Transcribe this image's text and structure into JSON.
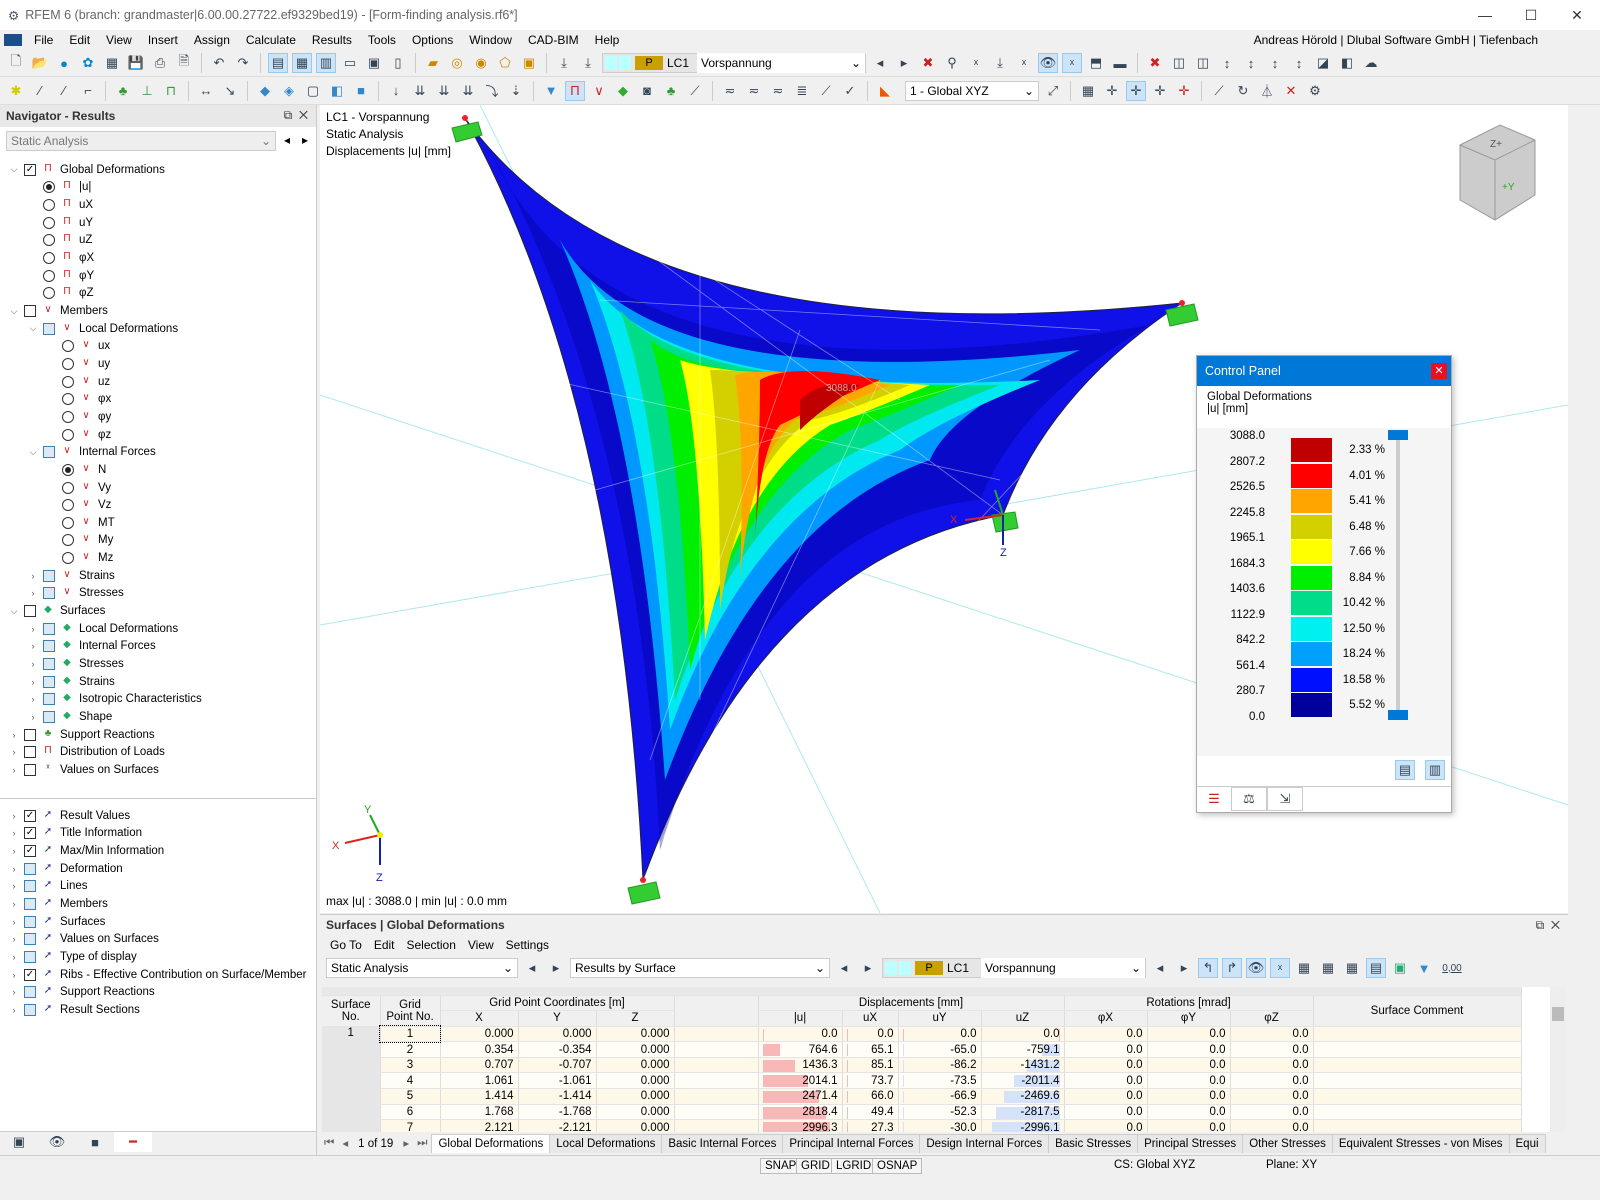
{
  "window": {
    "title": "RFEM 6 (branch: grandmaster|6.00.00.27722.ef9329bed19) - [Form-finding analysis.rf6*]"
  },
  "menu": [
    "File",
    "Edit",
    "View",
    "Insert",
    "Assign",
    "Calculate",
    "Results",
    "Tools",
    "Options",
    "Window",
    "CAD-BIM",
    "Help"
  ],
  "user": "Andreas Hörold | Dlubal Software GmbH | Tiefenbach",
  "toolbar": {
    "load_type": "P",
    "load_case": "LC1",
    "load_case_name": "Vorspannung",
    "coord_system": "1 - Global XYZ"
  },
  "navigator": {
    "title": "Navigator - Results",
    "analysis": "Static Analysis",
    "items": [
      {
        "l": 0,
        "t": "cb",
        "c": true,
        "e": "v",
        "i": "def",
        "label": "Global Deformations"
      },
      {
        "l": 1,
        "t": "rb",
        "c": true,
        "i": "def",
        "label": "|u|"
      },
      {
        "l": 1,
        "t": "rb",
        "i": "def",
        "label": "uX"
      },
      {
        "l": 1,
        "t": "rb",
        "i": "def",
        "label": "uY"
      },
      {
        "l": 1,
        "t": "rb",
        "i": "def",
        "label": "uZ"
      },
      {
        "l": 1,
        "t": "rb",
        "i": "def",
        "label": "φX"
      },
      {
        "l": 1,
        "t": "rb",
        "i": "def",
        "label": "φY"
      },
      {
        "l": 1,
        "t": "rb",
        "i": "def",
        "label": "φZ"
      },
      {
        "l": 0,
        "t": "cb",
        "e": "v",
        "i": "mem",
        "label": "Members"
      },
      {
        "l": 1,
        "t": "cbb",
        "e": "v",
        "i": "mem",
        "label": "Local Deformations"
      },
      {
        "l": 2,
        "t": "rb",
        "i": "mem",
        "label": "ux"
      },
      {
        "l": 2,
        "t": "rb",
        "i": "mem",
        "label": "uy"
      },
      {
        "l": 2,
        "t": "rb",
        "i": "mem",
        "label": "uz"
      },
      {
        "l": 2,
        "t": "rb",
        "i": "mem",
        "label": "φx"
      },
      {
        "l": 2,
        "t": "rb",
        "i": "mem",
        "label": "φy"
      },
      {
        "l": 2,
        "t": "rb",
        "i": "mem",
        "label": "φz"
      },
      {
        "l": 1,
        "t": "cbb",
        "e": "v",
        "i": "mem",
        "label": "Internal Forces"
      },
      {
        "l": 2,
        "t": "rb",
        "c": true,
        "i": "mem",
        "label": "N"
      },
      {
        "l": 2,
        "t": "rb",
        "i": "mem",
        "label": "Vy"
      },
      {
        "l": 2,
        "t": "rb",
        "i": "mem",
        "label": "Vz"
      },
      {
        "l": 2,
        "t": "rb",
        "i": "mem",
        "label": "MT"
      },
      {
        "l": 2,
        "t": "rb",
        "i": "mem",
        "label": "My"
      },
      {
        "l": 2,
        "t": "rb",
        "i": "mem",
        "label": "Mz"
      },
      {
        "l": 1,
        "t": "cbb",
        "e": ">",
        "i": "mem",
        "label": "Strains"
      },
      {
        "l": 1,
        "t": "cbb",
        "e": ">",
        "i": "mem",
        "label": "Stresses"
      },
      {
        "l": 0,
        "t": "cb",
        "e": "v",
        "i": "srf",
        "label": "Surfaces"
      },
      {
        "l": 1,
        "t": "cbb",
        "e": ">",
        "i": "srf",
        "label": "Local Deformations"
      },
      {
        "l": 1,
        "t": "cbb",
        "e": ">",
        "i": "srf",
        "label": "Internal Forces"
      },
      {
        "l": 1,
        "t": "cbb",
        "e": ">",
        "i": "srf",
        "label": "Stresses"
      },
      {
        "l": 1,
        "t": "cbb",
        "e": ">",
        "i": "srf",
        "label": "Strains"
      },
      {
        "l": 1,
        "t": "cbb",
        "e": ">",
        "i": "srf",
        "label": "Isotropic Characteristics"
      },
      {
        "l": 1,
        "t": "cbb",
        "e": ">",
        "i": "srf",
        "label": "Shape"
      },
      {
        "l": 0,
        "t": "cb",
        "e": ">",
        "i": "sup",
        "label": "Support Reactions"
      },
      {
        "l": 0,
        "t": "cb",
        "e": ">",
        "i": "def",
        "label": "Distribution of Loads"
      },
      {
        "l": 0,
        "t": "cb",
        "e": ">",
        "i": "val",
        "label": "Values on Surfaces"
      }
    ],
    "display_items": [
      {
        "c": true,
        "label": "Result Values"
      },
      {
        "c": true,
        "label": "Title Information"
      },
      {
        "c": true,
        "label": "Max/Min Information"
      },
      {
        "label": "Deformation"
      },
      {
        "label": "Lines"
      },
      {
        "label": "Members"
      },
      {
        "label": "Surfaces"
      },
      {
        "label": "Values on Surfaces"
      },
      {
        "label": "Type of display"
      },
      {
        "c": true,
        "label": "Ribs - Effective Contribution on Surface/Member"
      },
      {
        "label": "Support Reactions"
      },
      {
        "label": "Result Sections"
      }
    ]
  },
  "viewport": {
    "line1": "LC1 - Vorspannung",
    "line2": "Static Analysis",
    "line3": "Displacements |u| [mm]",
    "maxmin": "max |u| : 3088.0 | min |u| : 0.0 mm",
    "max_label": "3088.0",
    "axes": {
      "x": "X",
      "y": "Y",
      "z": "Z"
    }
  },
  "control_panel": {
    "title": "Control Panel",
    "subtitle": "Global Deformations",
    "unit": "|u| [mm]",
    "values": [
      "3088.0",
      "2807.2",
      "2526.5",
      "2245.8",
      "1965.1",
      "1684.3",
      "1403.6",
      "1122.9",
      "842.2",
      "561.4",
      "280.7",
      "0.0"
    ],
    "colors": [
      "#c00000",
      "#ff0000",
      "#ffa500",
      "#d4d000",
      "#ffff00",
      "#00ee00",
      "#00dd88",
      "#00f0f0",
      "#00a0ff",
      "#0010ff",
      "#00009c"
    ],
    "percents": [
      "2.33 %",
      "4.01 %",
      "5.41 %",
      "6.48 %",
      "7.66 %",
      "8.84 %",
      "10.42 %",
      "12.50 %",
      "18.24 %",
      "18.58 %",
      "5.52 %"
    ]
  },
  "table": {
    "title": "Surfaces | Global Deformations",
    "menu": [
      "Go To",
      "Edit",
      "Selection",
      "View",
      "Settings"
    ],
    "analysis": "Static Analysis",
    "results_by": "Results by Surface",
    "load_type": "P",
    "load_case": "LC1",
    "load_case_name": "Vorspannung",
    "decimals": "0,00",
    "group_headers": {
      "surface": "Surface No.",
      "grid": "Grid Point No.",
      "coords": "Grid Point Coordinates [m]",
      "disp": "Displacements [mm]",
      "rot": "Rotations [mrad]",
      "comment": "Surface Comment"
    },
    "cols": [
      "X",
      "Y",
      "Z",
      "|u|",
      "uX",
      "uY",
      "uZ",
      "φX",
      "φY",
      "φZ"
    ],
    "surface_no": "1",
    "rows": [
      [
        "1",
        "0.000",
        "0.000",
        "0.000",
        "0.0",
        "0.0",
        "0.0",
        "0.0",
        "0.0",
        "0.0",
        "0.0"
      ],
      [
        "2",
        "0.354",
        "-0.354",
        "0.000",
        "764.6",
        "65.1",
        "-65.0",
        "-759.1",
        "0.0",
        "0.0",
        "0.0"
      ],
      [
        "3",
        "0.707",
        "-0.707",
        "0.000",
        "1436.3",
        "85.1",
        "-86.2",
        "-1431.2",
        "0.0",
        "0.0",
        "0.0"
      ],
      [
        "4",
        "1.061",
        "-1.061",
        "0.000",
        "2014.1",
        "73.7",
        "-73.5",
        "-2011.4",
        "0.0",
        "0.0",
        "0.0"
      ],
      [
        "5",
        "1.414",
        "-1.414",
        "0.000",
        "2471.4",
        "66.0",
        "-66.9",
        "-2469.6",
        "0.0",
        "0.0",
        "0.0"
      ],
      [
        "6",
        "1.768",
        "-1.768",
        "0.000",
        "2818.4",
        "49.4",
        "-52.3",
        "-2817.5",
        "0.0",
        "0.0",
        "0.0"
      ],
      [
        "7",
        "2.121",
        "-2.121",
        "0.000",
        "2996.3",
        "27.3",
        "-30.0",
        "-2996.1",
        "0.0",
        "0.0",
        "0.0"
      ]
    ],
    "pager": "1 of 19",
    "tabs": [
      "Global Deformations",
      "Local Deformations",
      "Basic Internal Forces",
      "Principal Internal Forces",
      "Design Internal Forces",
      "Basic Stresses",
      "Principal Stresses",
      "Other Stresses",
      "Equivalent Stresses - von Mises",
      "Equi"
    ]
  },
  "status": {
    "snap": "SNAP",
    "grid": "GRID",
    "lgrid": "LGRID",
    "osnap": "OSNAP",
    "cs": "CS: Global XYZ",
    "plane": "Plane: XY"
  }
}
